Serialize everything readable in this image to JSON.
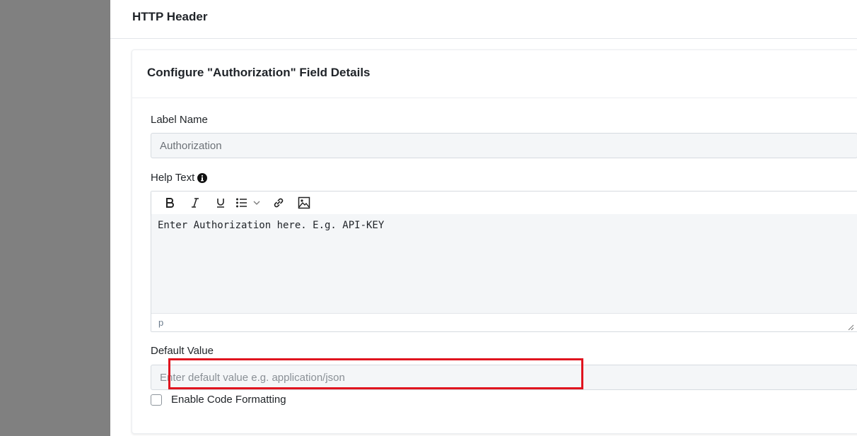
{
  "page": {
    "title": "HTTP Header"
  },
  "card": {
    "title": "Configure \"Authorization\" Field Details"
  },
  "fields": {
    "label_name": {
      "label": "Label Name",
      "value": "Authorization"
    },
    "help_text": {
      "label": "Help Text",
      "content": "Enter Authorization here. E.g. API-KEY",
      "status_path": "p",
      "toolbar": [
        "bold-icon",
        "italic-icon",
        "underline-icon",
        "bullet-list-icon",
        "link-icon",
        "image-icon"
      ]
    },
    "default_value": {
      "label": "Default Value",
      "placeholder": "Enter default value e.g. application/json",
      "value": ""
    },
    "code_formatting": {
      "label": "Enable Code Formatting",
      "checked": false
    }
  },
  "colors": {
    "left_rail": "#808080",
    "input_bg": "#f4f6f8",
    "highlight": "#e0141f"
  }
}
